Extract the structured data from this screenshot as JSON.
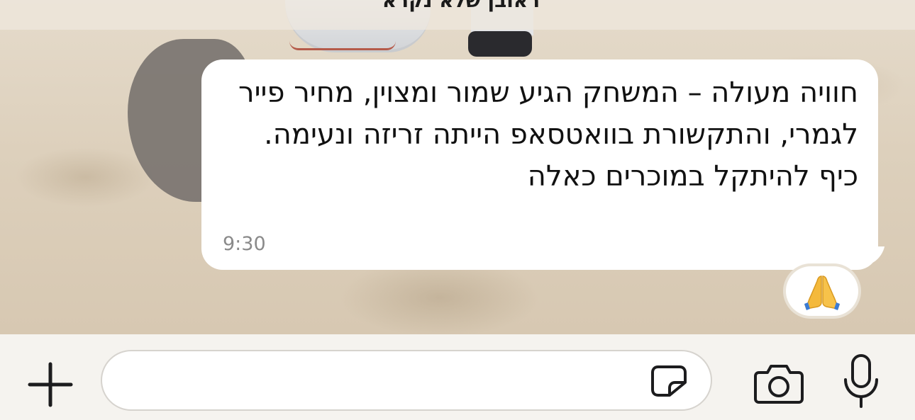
{
  "chat": {
    "header_name": "ראובן שלא נקרא"
  },
  "message": {
    "text": "חוויה מעולה – המשחק הגיע שמור ומצוין, מחיר פייר לגמרי, והתקשורת בוואטסאפ הייתה זריזה ונעימה. כיף להיתקל במוכרים כאלה",
    "time": "9:30",
    "reaction": "🙏",
    "reaction_icon": "folded-hands-icon"
  },
  "composer": {
    "input_value": "",
    "icons": {
      "plus": "plus-icon",
      "sticker": "sticker-icon",
      "camera": "camera-icon",
      "mic": "microphone-icon"
    }
  },
  "colors": {
    "bubble": "#ffffff",
    "input_bar": "#f5f3ef",
    "icon": "#1c1c1e",
    "timestamp": "#8a8a8a"
  }
}
